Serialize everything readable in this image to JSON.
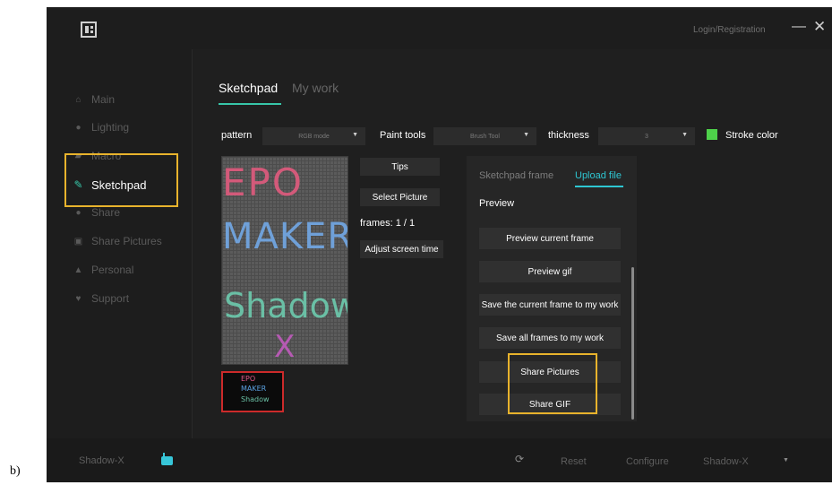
{
  "titlebar": {
    "login_label": "Login/Registration",
    "minimize_icon": "minimize-icon",
    "close_icon": "close-icon"
  },
  "sidebar": {
    "items": [
      {
        "label": "Main",
        "icon": "home-icon"
      },
      {
        "label": "Lighting",
        "icon": "bulb-icon"
      },
      {
        "label": "Macro",
        "icon": "macro-icon"
      },
      {
        "label": "Sketchpad",
        "icon": "sketchpad-icon"
      },
      {
        "label": "Share",
        "icon": "share-icon"
      },
      {
        "label": "Share Pictures",
        "icon": "share-pictures-icon"
      },
      {
        "label": "Personal",
        "icon": "person-icon"
      },
      {
        "label": "Support",
        "icon": "heart-icon"
      }
    ],
    "active": "Sketchpad"
  },
  "tabs": {
    "sketchpad": "Sketchpad",
    "my_work": "My work"
  },
  "toolbar": {
    "pattern_label": "pattern",
    "pattern_value": "RGB mode",
    "paint_tools_label": "Paint tools",
    "paint_tools_value": "Brush Tool",
    "thickness_label": "thickness",
    "thickness_value": "3",
    "stroke_color_label": "Stroke color",
    "stroke_color": "#4ed14a"
  },
  "canvas": {
    "lines": [
      "EPO",
      "MAKER",
      "Shadow",
      "X"
    ],
    "thumbnail_lines": [
      "EPO",
      "MAKER",
      "Shadow"
    ]
  },
  "middle": {
    "tips": "Tips",
    "select_picture": "Select Picture",
    "frames": "frames: 1 / 1",
    "adjust_screen_time": "Adjust screen time"
  },
  "panel": {
    "tab_sketchpad_frame": "Sketchpad frame",
    "tab_upload_file": "Upload file",
    "preview_label": "Preview",
    "buttons": [
      "Preview current frame",
      "Preview gif",
      "Save the current frame to my work",
      "Save all frames to my work",
      "Share Pictures",
      "Share GIF"
    ]
  },
  "footer": {
    "device_name": "Shadow-X",
    "reset": "Reset",
    "configure": "Configure",
    "profile": "Shadow-X"
  },
  "caption": "b)",
  "colors": {
    "accent": "#37c6a8",
    "highlight": "#e8b32c",
    "upload_tab": "#2ec6d2"
  }
}
